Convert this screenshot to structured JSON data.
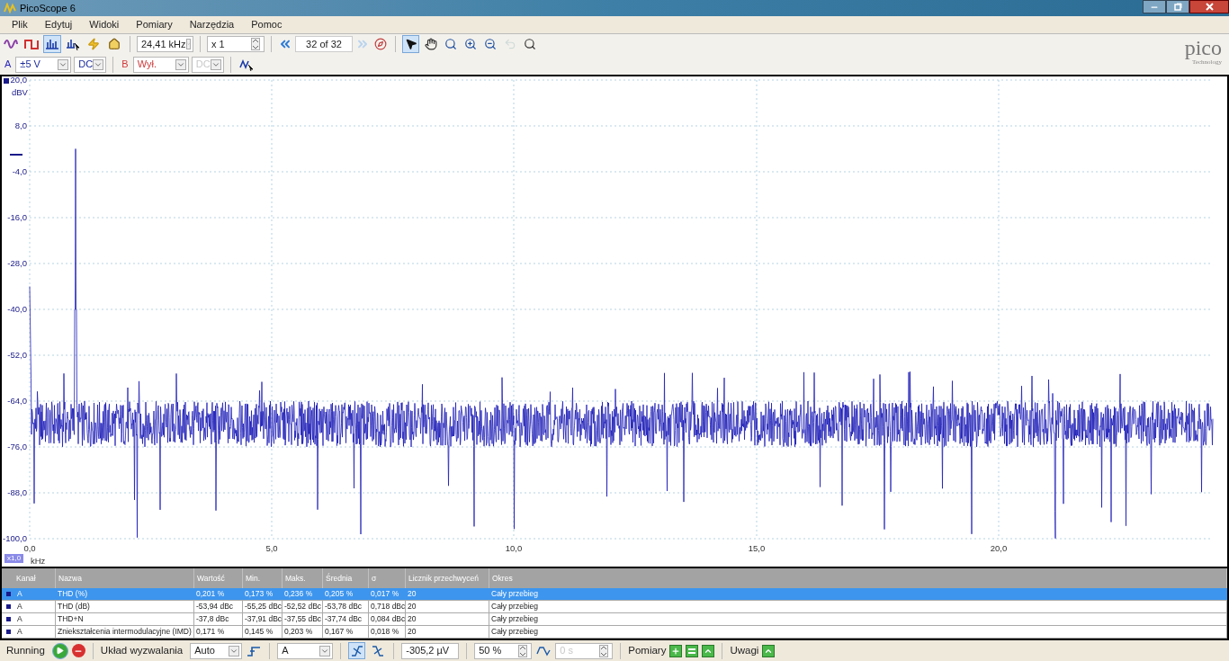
{
  "window": {
    "title": "PicoScope 6"
  },
  "menu": [
    "Plik",
    "Edytuj",
    "Widoki",
    "Pomiary",
    "Narzędzia",
    "Pomoc"
  ],
  "toolbar": {
    "view_modes": [
      {
        "kind": "scope",
        "selected": false
      },
      {
        "kind": "persistence",
        "selected": false
      },
      {
        "kind": "spectrum",
        "selected": true
      }
    ],
    "frequency": "24,41 kHz",
    "zoom": "x 1",
    "buffer": "32 of 32",
    "forward_disabled": true,
    "tools": [
      {
        "kind": "pointer",
        "selected": true,
        "disabled": false
      },
      {
        "kind": "hand",
        "selected": false,
        "disabled": false
      },
      {
        "kind": "zoom",
        "selected": false,
        "disabled": false
      },
      {
        "kind": "zoom-in",
        "selected": false,
        "disabled": false
      },
      {
        "kind": "zoom-out",
        "selected": false,
        "disabled": false
      },
      {
        "kind": "undo",
        "selected": false,
        "disabled": true
      },
      {
        "kind": "overview",
        "selected": false,
        "disabled": false
      }
    ]
  },
  "logo": {
    "name": "pico",
    "tagline": "Technology"
  },
  "channels": [
    {
      "label": "A",
      "range": "±5 V",
      "coupling": "DC",
      "color": "#2a2ab8",
      "enabled": true
    },
    {
      "label": "B",
      "range": "Wył.",
      "coupling": "DC",
      "color": "#d03a3a",
      "enabled": false
    }
  ],
  "plot": {
    "y_unit": "dBV",
    "y_ticks": [
      "20,0",
      "8,0",
      "-4,0",
      "-16,0",
      "-28,0",
      "-40,0",
      "-52,0",
      "-64,0",
      "-76,0",
      "-88,0",
      "-100,0"
    ],
    "x_ticks": [
      "0,0",
      "5,0",
      "10,0",
      "15,0",
      "20,0"
    ],
    "x_unit": "kHz",
    "x_zoom": "x1,0"
  },
  "table": {
    "columns": [
      "Kanał",
      "Nazwa",
      "Wartość",
      "Min.",
      "Maks.",
      "Średnia",
      "σ",
      "Licznik przechwyceń",
      "Okres"
    ],
    "rows": [
      {
        "selected": true,
        "cells": [
          "A",
          "THD (%)",
          "0,201 %",
          "0,173 %",
          "0,236 %",
          "0,205 %",
          "0,017 %",
          "20",
          "Cały przebieg"
        ]
      },
      {
        "selected": false,
        "cells": [
          "A",
          "THD (dB)",
          "-53,94 dBc",
          "-55,25 dBc",
          "-52,52 dBc",
          "-53,78 dBc",
          "0,718 dBc",
          "20",
          "Cały przebieg"
        ]
      },
      {
        "selected": false,
        "cells": [
          "A",
          "THD+N",
          "-37,8 dBc",
          "-37,91 dBc",
          "-37,55 dBc",
          "-37,74 dBc",
          "0,084 dBc",
          "20",
          "Cały przebieg"
        ]
      },
      {
        "selected": false,
        "cells": [
          "A",
          "Zniekształcenia intermodulacyjne (IMD)",
          "0,171 %",
          "0,145 %",
          "0,203 %",
          "0,167 %",
          "0,018 %",
          "20",
          "Cały przebieg"
        ]
      }
    ]
  },
  "status_bar": {
    "run_state": "Running",
    "trigger_label": "Układ wyzwalania",
    "trigger_mode": "Auto",
    "trigger_source": "A",
    "edges": [
      {
        "kind": "rising",
        "selected": true
      },
      {
        "kind": "falling",
        "selected": false
      }
    ],
    "threshold": "-305,2 µV",
    "pretrigger": "50 %",
    "delay": "0 s",
    "delay_disabled": true,
    "measurements_label": "Pomiary",
    "notes_label": "Uwagi"
  }
}
